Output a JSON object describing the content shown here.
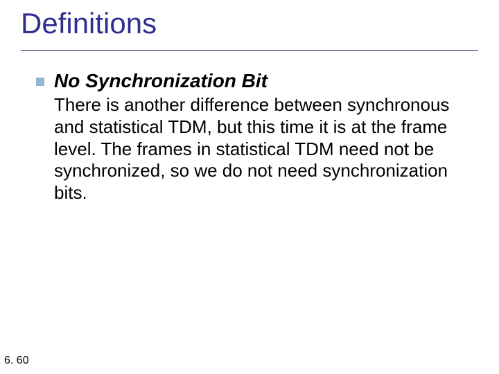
{
  "slide": {
    "title": "Definitions",
    "bullet": {
      "heading": "No Synchronization Bit",
      "text": "There is another difference between synchronous and statistical TDM, but this time it is at the frame level. The frames in statistical TDM need not be synchronized, so we do not need synchronization bits."
    },
    "page_number": "6. 60"
  }
}
